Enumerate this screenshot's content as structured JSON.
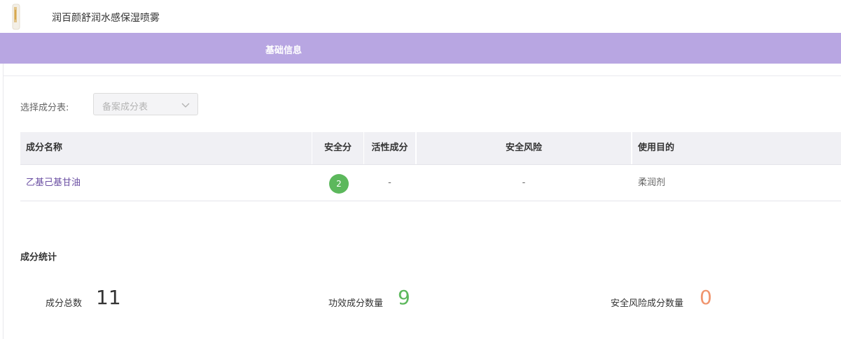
{
  "header": {
    "product_name": "润百颜舒润水感保湿喷雾"
  },
  "nav": {
    "tab_label": "基础信息"
  },
  "filter": {
    "label": "选择成分表:",
    "selected": "备案成分表"
  },
  "table": {
    "headers": {
      "name": "成分名称",
      "score": "安全分",
      "active": "活性成分",
      "risk": "安全风险",
      "purpose": "使用目的"
    },
    "rows": [
      {
        "name": "乙基己基甘油",
        "score": "2",
        "active": "-",
        "risk": "-",
        "purpose": "柔润剂"
      }
    ]
  },
  "stats": {
    "title": "成分统计",
    "items": [
      {
        "label": "成分总数",
        "value": "11",
        "color": "#333333"
      },
      {
        "label": "功效成分数量",
        "value": "9",
        "color": "#5cb85c"
      },
      {
        "label": "安全风险成分数量",
        "value": "0",
        "color": "#f0956e"
      }
    ]
  },
  "colors": {
    "nav_bg": "#b8a6e2",
    "accent": "#6b4fa3",
    "score_green": "#5cb85c"
  }
}
